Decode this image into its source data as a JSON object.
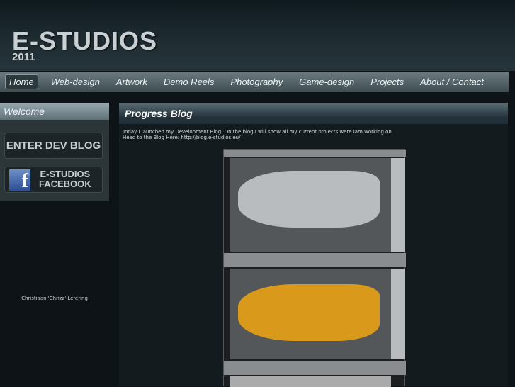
{
  "logo": {
    "title": "E-STUDIOS",
    "year": "2011"
  },
  "nav": [
    "Home",
    "Web-design",
    "Artwork",
    "Demo Reels",
    "Photography",
    "Game-design",
    "Projects",
    "About / Contact"
  ],
  "sidebar": {
    "welcome": "Welcome",
    "devblog": "ENTER DEV BLOG",
    "facebook_line1": "E-STUDIOS",
    "facebook_line2": "FACEBOOK",
    "fb_letter": "f",
    "author": "Christiaan 'Chrizz' Lefering"
  },
  "main": {
    "title": "Progress Blog",
    "line1": "Today I launched my Development Blog. On the blog I will show all my current projects were Iam working on.",
    "line2_prefix": "Head to the Blog Here:",
    "link": " http://blog.e-studios.eu/"
  }
}
